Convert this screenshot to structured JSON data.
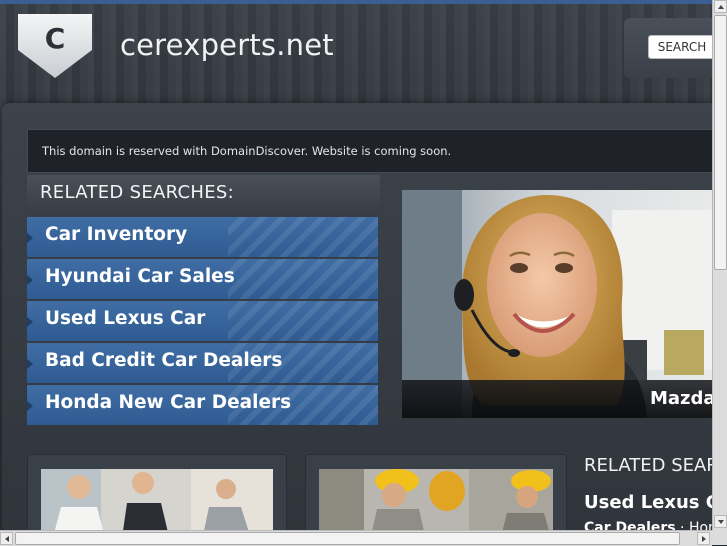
{
  "header": {
    "logo_letter": "C",
    "site_title": "cerexperts.net",
    "search_button": "SEARCH"
  },
  "notice": {
    "text": "This domain is reserved with DomainDiscover. Website is coming soon."
  },
  "related_searches": {
    "title": "RELATED SEARCHES:",
    "items": [
      {
        "label": "Car Inventory"
      },
      {
        "label": "Hyundai Car Sales"
      },
      {
        "label": "Used Lexus Car"
      },
      {
        "label": "Bad Credit Car Dealers"
      },
      {
        "label": "Honda New Car Dealers"
      }
    ]
  },
  "featured": {
    "caption": "Mazda"
  },
  "related_right": {
    "title": "RELATED SEAR",
    "link": "Used Lexus Ca",
    "sub_bold": "Car Dealers",
    "sub_rest": " · Hon"
  },
  "colors": {
    "accent_blue": "#3b6aa2",
    "top_bar": "#3b5f93",
    "background": "#2c3138"
  }
}
